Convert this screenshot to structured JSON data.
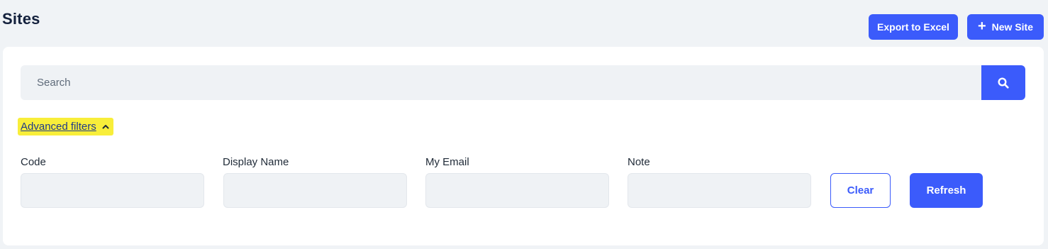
{
  "header": {
    "title": "Sites",
    "export_label": "Export to Excel",
    "new_label": "New Site",
    "new_icon": "plus-icon"
  },
  "search": {
    "placeholder": "Search",
    "value": "",
    "button_icon": "search-icon"
  },
  "advanced_filters": {
    "label": "Advanced filters",
    "expanded": true,
    "toggle_icon": "chevron-up-icon",
    "highlight_color": "#f8ee3a"
  },
  "filters": {
    "code": {
      "label": "Code",
      "value": ""
    },
    "display_name": {
      "label": "Display Name",
      "value": ""
    },
    "my_email": {
      "label": "My Email",
      "value": ""
    },
    "note": {
      "label": "Note",
      "value": ""
    }
  },
  "actions": {
    "clear_label": "Clear",
    "refresh_label": "Refresh"
  },
  "colors": {
    "accent": "#3b5bfb",
    "background": "#f0f3f6",
    "input_background": "#eff2f5"
  }
}
